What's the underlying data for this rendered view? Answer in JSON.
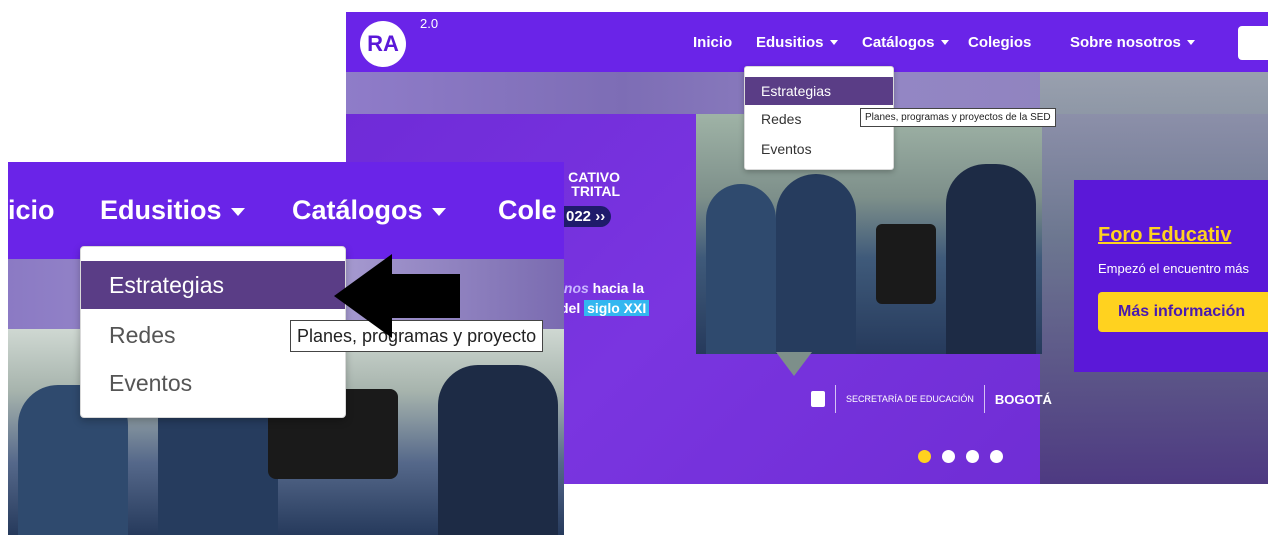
{
  "navbar": {
    "logo_text": "RA",
    "logo_version": "2.0",
    "items": [
      {
        "label": "Inicio"
      },
      {
        "label": "Edusitios"
      },
      {
        "label": "Catálogos"
      },
      {
        "label": "Colegios"
      },
      {
        "label": "Sobre nosotros"
      }
    ]
  },
  "dropdown": {
    "items": [
      {
        "label": "Estrategias",
        "active": true
      },
      {
        "label": "Redes"
      },
      {
        "label": "Eventos"
      }
    ],
    "tooltip": "Planes, programas y proyectos de la SED"
  },
  "hero": {
    "headline_partial": "CATIVO TRITAL",
    "year_pill": "022 ››",
    "tagline_italic": "inos",
    "tagline_1": " hacia la",
    "tagline_2a": "del ",
    "tagline_2b": "siglo XXI",
    "sponsor_1": "SECRETARÍA DE EDUCACIÓN",
    "sponsor_2": "BOGOTÁ"
  },
  "panel": {
    "title": "Foro Educativ",
    "subtitle": "Empezó el encuentro más",
    "button": "Más información"
  },
  "carousel": {
    "count": 4,
    "active": 0
  },
  "zoom": {
    "nav": [
      {
        "label": "icio"
      },
      {
        "label": "Edusitios"
      },
      {
        "label": "Catálogos"
      },
      {
        "label": "Cole"
      }
    ],
    "tooltip": "Planes, programas y proyecto"
  },
  "colors": {
    "brand_purple": "#6a24e8",
    "accent_yellow": "#ffd21f",
    "dropdown_active": "#5a3d86"
  }
}
